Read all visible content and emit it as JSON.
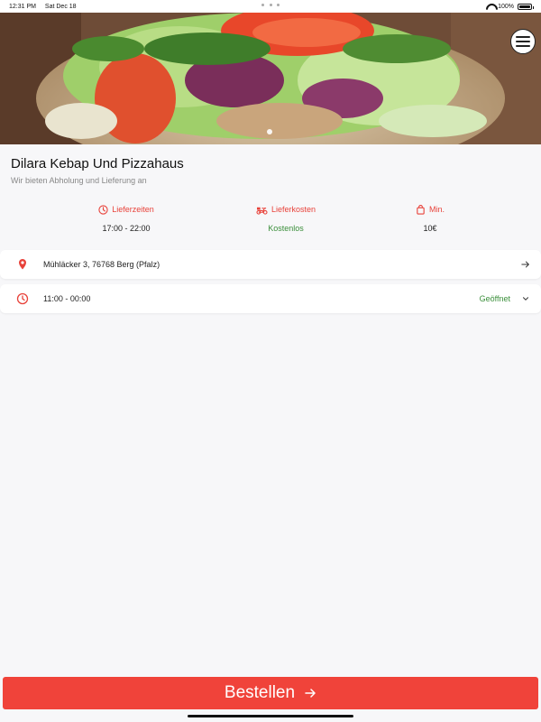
{
  "status_bar": {
    "time": "12:31 PM",
    "date": "Sat Dec 18",
    "battery_text": "100%",
    "battery_level": 1.0,
    "icons": [
      "wifi-icon",
      "battery-icon"
    ]
  },
  "hero": {
    "icons": [
      "menu-icon"
    ],
    "pager": {
      "count": 1,
      "active": 0
    }
  },
  "restaurant": {
    "name": "Dilara Kebap Und Pizzahaus",
    "tagline": "Wir bieten Abholung und Lieferung an"
  },
  "info": {
    "delivery_times": {
      "label": "Lieferzeiten",
      "value": "17:00 - 22:00",
      "icon": "clock-icon"
    },
    "delivery_cost": {
      "label": "Lieferkosten",
      "value": "Kostenlos",
      "icon": "scooter-icon"
    },
    "minimum": {
      "label": "Min.",
      "value": "10€",
      "icon": "bag-icon"
    }
  },
  "address_row": {
    "text": "Mühläcker 3, 76768 Berg (Pfalz)",
    "icon": "location-pin-icon",
    "action_icon": "arrow-right-icon"
  },
  "hours_row": {
    "text": "11:00 - 00:00",
    "status": "Geöffnet",
    "icon": "clock-icon",
    "action_icon": "chevron-down-icon"
  },
  "order_button": {
    "label": "Bestellen",
    "icon": "arrow-right-icon"
  },
  "colors": {
    "accent": "#f0433a",
    "open_green": "#3b8f3b",
    "background": "#f7f7f9"
  }
}
